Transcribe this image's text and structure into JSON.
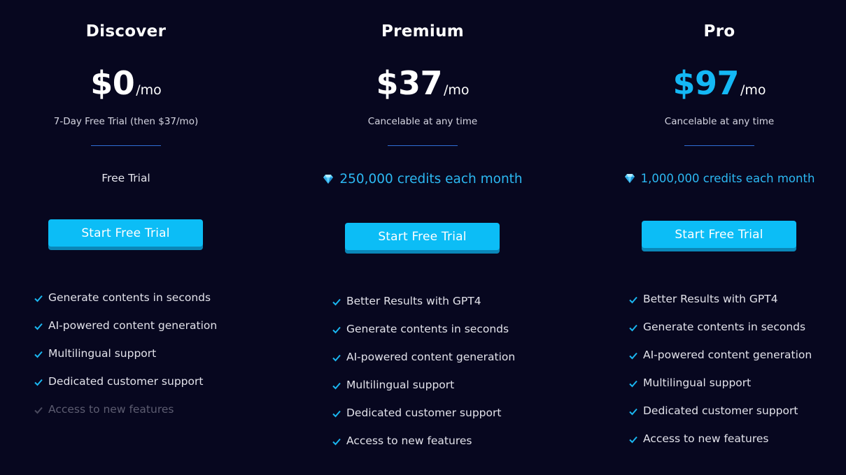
{
  "colors": {
    "background": "#07071f",
    "accent": "#0cbdf6",
    "check": "#1ab6f0",
    "disabled": "#5c5c70"
  },
  "plans": [
    {
      "name": "Discover",
      "price": "$0",
      "period": "/mo",
      "note": "7-Day Free Trial (then $37/mo)",
      "credits": "Free Trial",
      "cta": "Start Free Trial",
      "features": [
        {
          "label": "Generate contents in seconds",
          "enabled": true
        },
        {
          "label": "AI-powered content generation",
          "enabled": true
        },
        {
          "label": "Multilingual support",
          "enabled": true
        },
        {
          "label": "Dedicated customer support",
          "enabled": true
        },
        {
          "label": "Access to new features",
          "enabled": false
        }
      ]
    },
    {
      "name": "Premium",
      "price": "$37",
      "period": "/mo",
      "note": "Cancelable at any time",
      "credits_icon": "gem-icon",
      "credits": "250,000 credits each month",
      "cta": "Start Free Trial",
      "features": [
        {
          "label": "Better Results with GPT4",
          "enabled": true
        },
        {
          "label": "Generate contents in seconds",
          "enabled": true
        },
        {
          "label": "AI-powered content generation",
          "enabled": true
        },
        {
          "label": "Multilingual support",
          "enabled": true
        },
        {
          "label": "Dedicated customer support",
          "enabled": true
        },
        {
          "label": "Access to new features",
          "enabled": true
        }
      ]
    },
    {
      "name": "Pro",
      "price": "$97",
      "period": "/mo",
      "price_color": "#14b8f5",
      "note": "Cancelable at any time",
      "credits_icon": "gem-icon",
      "credits": "1,000,000 credits each month",
      "cta": "Start Free Trial",
      "features": [
        {
          "label": "Better Results with GPT4",
          "enabled": true
        },
        {
          "label": "Generate contents in seconds",
          "enabled": true
        },
        {
          "label": "AI-powered content generation",
          "enabled": true
        },
        {
          "label": "Multilingual support",
          "enabled": true
        },
        {
          "label": "Dedicated customer support",
          "enabled": true
        },
        {
          "label": "Access to new features",
          "enabled": true
        }
      ]
    }
  ]
}
